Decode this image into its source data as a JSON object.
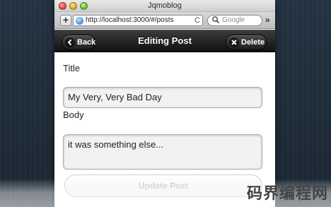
{
  "window": {
    "title": "Jqmoblog"
  },
  "toolbar": {
    "plus_label": "+",
    "url": "http://localhost:3000/#/posts",
    "reload_glyph": "C",
    "search_placeholder": "Google",
    "more_glyph": "»"
  },
  "header": {
    "title": "Editing Post",
    "back_label": "Back",
    "delete_label": "Delete",
    "back_icon": "chevron-left-icon",
    "delete_icon": "close-icon"
  },
  "form": {
    "title_label": "Title",
    "title_value": "My Very, Very Bad Day",
    "body_label": "Body",
    "body_value": "it was something else...",
    "submit_label": "Update Post"
  },
  "watermark": {
    "text": "码界编程网"
  }
}
